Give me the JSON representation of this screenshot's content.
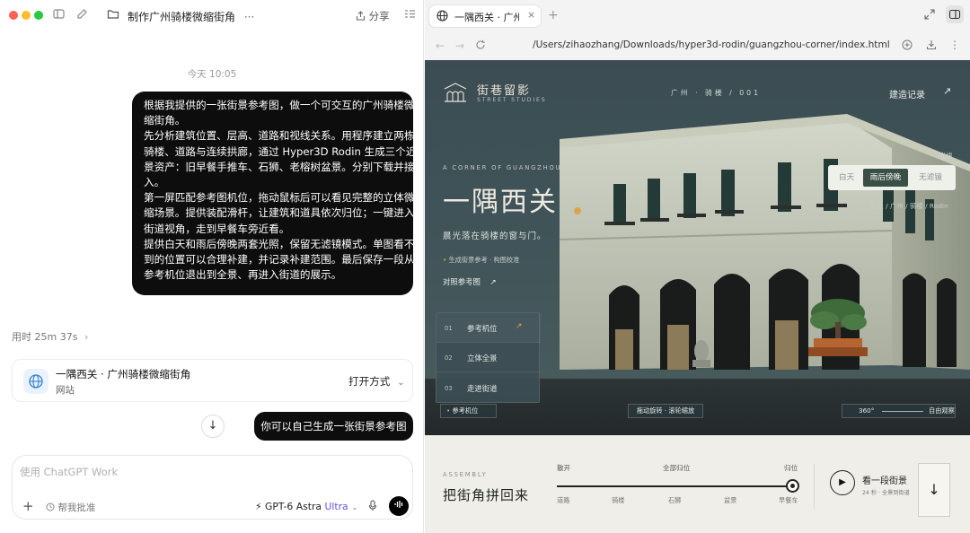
{
  "chat": {
    "conversation_title": "制作广州骑楼微缩街角",
    "more_menu": "···",
    "share_label": "分享",
    "timestamp": "今天 10:05",
    "user_message_lines": [
      "根据我提供的一张街景参考图，做一个可交互的广州骑楼微",
      "缩街角。",
      "先分析建筑位置、层高、道路和视线关系。用程序建立两栋",
      "骑楼、道路与连续拱廊，通过 Hyper3D Rodin 生成三个近",
      "景资产：旧早餐手推车、石狮、老榕树盆景。分别下载并接",
      "入。",
      "第一屏匹配参考图机位，拖动鼠标后可以看见完整的立体微",
      "缩场景。提供装配滑杆，让建筑和道具依次归位；一键进入",
      "街道视角，走到早餐车旁近看。",
      "提供白天和雨后傍晚两套光照，保留无滤镜模式。单图看不",
      "到的位置可以合理补建，并记录补建范围。最后保存一段从",
      "参考机位退出到全景、再进入街道的展示。"
    ],
    "elapsed": "用时 25m 37s",
    "artifact_title": "一隅西关 · 广州骑楼微缩街角",
    "artifact_type": "网站",
    "open_with": "打开方式",
    "user_message_2": "你可以自己生成一张街景参考图",
    "composer_placeholder": "使用 ChatGPT Work",
    "help_label": "帮我批准",
    "model_name": "GPT-6 Astra",
    "model_tier": "Ultra"
  },
  "browser": {
    "tab_title": "一隅西关 · 广州",
    "url": "/Users/zihaozhang/Downloads/hyper3d-rodin/guangzhou-corner/index.html"
  },
  "site": {
    "brand_name": "街巷留影",
    "brand_sub": "STREET STUDIES",
    "nav_mid": "广州  ·  骑楼   /   001",
    "build_record": "建造记录",
    "eyebrow": "A CORNER OF GUANGZHOU",
    "hero_title": "一隅西关",
    "hero_sub": "晨光落在骑楼的窗与门。",
    "ref_note": "生成街景参考 · 构图校准",
    "compare_label": "对照参考图",
    "light_label": "光线",
    "light_options": [
      "白天",
      "雨后傍晚",
      "无滤镜"
    ],
    "light_selected": "雨后傍晚",
    "breadcrumb": "历史 / 广州 / 骑楼 / Rodin",
    "panel": [
      {
        "num": "01",
        "label": "参考机位"
      },
      {
        "num": "02",
        "label": "立体全景"
      },
      {
        "num": "03",
        "label": "走进街道"
      }
    ],
    "ref_pos_btn": "参考机位",
    "drag_hint": "拖动旋转 · 滚轮缩放",
    "free_obs_left": "360°",
    "free_obs_right": "自由观察",
    "assembly_eyebrow": "ASSEMBLY",
    "assembly_title": "把街角拼回来",
    "slider_left": "散开",
    "slider_mid": "全部归位",
    "slider_right": "归位",
    "slider_level": 1.0,
    "slider_ticks": [
      "道路",
      "骑楼",
      "石狮",
      "盆景",
      "早餐车"
    ],
    "watch_title": "看一段街景",
    "watch_sub": "24 秒 · 全景到街道"
  }
}
